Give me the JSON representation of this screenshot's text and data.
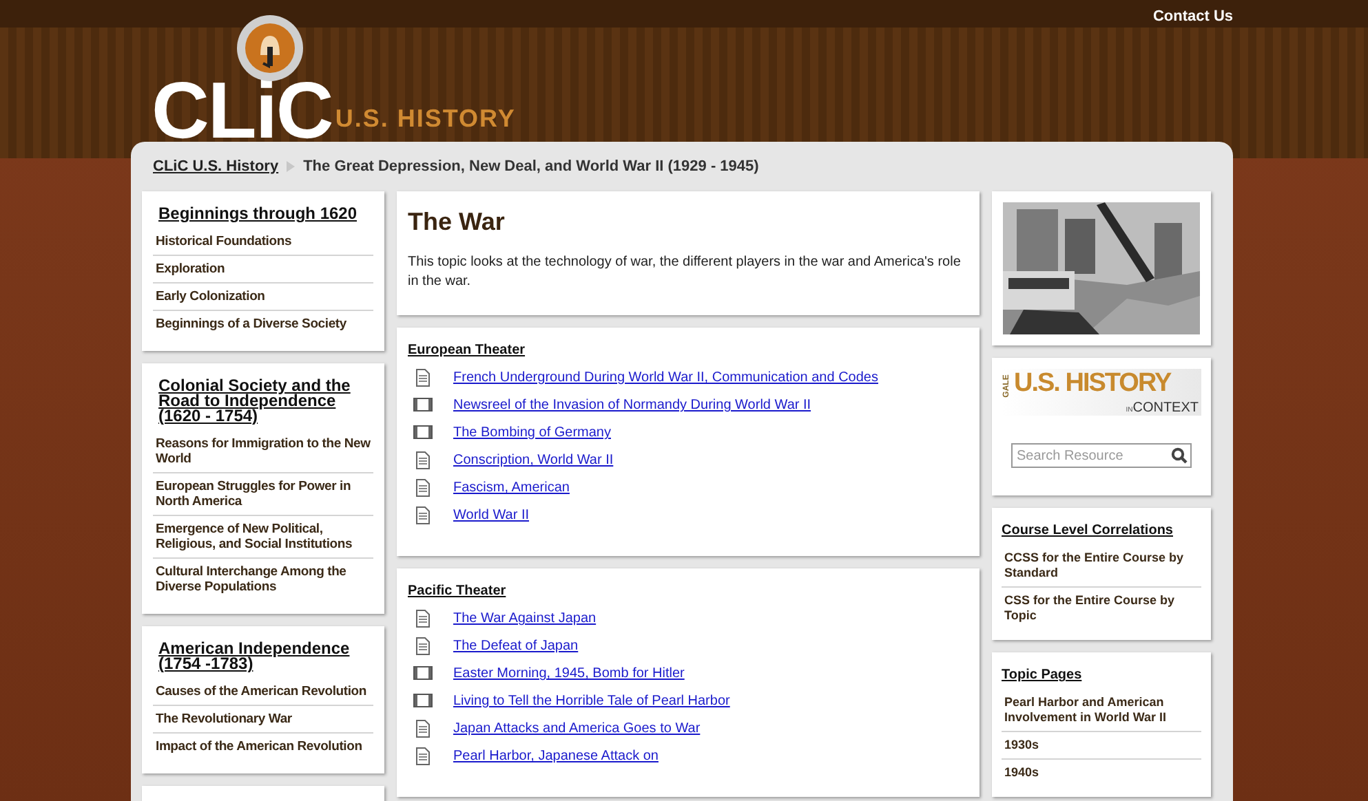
{
  "header": {
    "contact_link": "Contact Us",
    "logo": {
      "main": "CLiC",
      "sub": "U.S. HISTORY"
    }
  },
  "breadcrumb": [
    {
      "label": "CLiC U.S. History",
      "link": true
    },
    {
      "label": "The Great Depression, New Deal, and World War II (1929 - 1945)",
      "link": false
    }
  ],
  "left_nav": [
    {
      "heading": "Beginnings through 1620",
      "items": [
        "Historical Foundations",
        "Exploration",
        "Early Colonization",
        "Beginnings of a Diverse Society"
      ]
    },
    {
      "heading": "Colonial Society and the Road to Independence (1620 - 1754)",
      "items": [
        "Reasons for Immigration to the New World",
        "European Struggles for Power in North America",
        "Emergence of New Political, Religious, and Social Institutions",
        "Cultural Interchange Among the Diverse Populations"
      ]
    },
    {
      "heading": "American Independence (1754 -1783)",
      "items": [
        "Causes of the American Revolution",
        "The Revolutionary War",
        "Impact of the American Revolution"
      ]
    }
  ],
  "topic": {
    "title": "The War",
    "description": "This topic looks at the technology of war, the different players in the war and America's role in the war."
  },
  "sections": [
    {
      "heading": "European Theater",
      "links": [
        {
          "kind": "document",
          "label": "French Underground During World War II, Communication and Codes"
        },
        {
          "kind": "video",
          "label": "Newsreel of the Invasion of Normandy During World War II"
        },
        {
          "kind": "video",
          "label": "The Bombing of Germany"
        },
        {
          "kind": "document",
          "label": "Conscription, World War II"
        },
        {
          "kind": "document",
          "label": "Fascism, American"
        },
        {
          "kind": "document",
          "label": "World War II"
        }
      ]
    },
    {
      "heading": "Pacific Theater",
      "links": [
        {
          "kind": "document",
          "label": "The War Against Japan"
        },
        {
          "kind": "document",
          "label": "The Defeat of Japan"
        },
        {
          "kind": "video",
          "label": "Easter Morning, 1945, Bomb for Hitler"
        },
        {
          "kind": "video",
          "label": "Living to Tell the Horrible Tale of Pearl Harbor"
        },
        {
          "kind": "document",
          "label": "Japan Attacks and America Goes to War"
        },
        {
          "kind": "document",
          "label": "Pearl Harbor, Japanese Attack on"
        }
      ]
    }
  ],
  "resource": {
    "brand": "GALE",
    "title": "U.S. HISTORY",
    "sub_prefix": "IN",
    "sub": "CONTEXT",
    "search": {
      "placeholder": "Search Resource"
    }
  },
  "right_lists": [
    {
      "heading": "Course Level Correlations",
      "items": [
        "CCSS for the Entire Course by Standard",
        "CSS for the Entire Course by Topic"
      ]
    },
    {
      "heading": "Topic Pages",
      "items": [
        "Pearl Harbor and American Involvement in World War II",
        "1930s",
        "1940s"
      ]
    }
  ]
}
